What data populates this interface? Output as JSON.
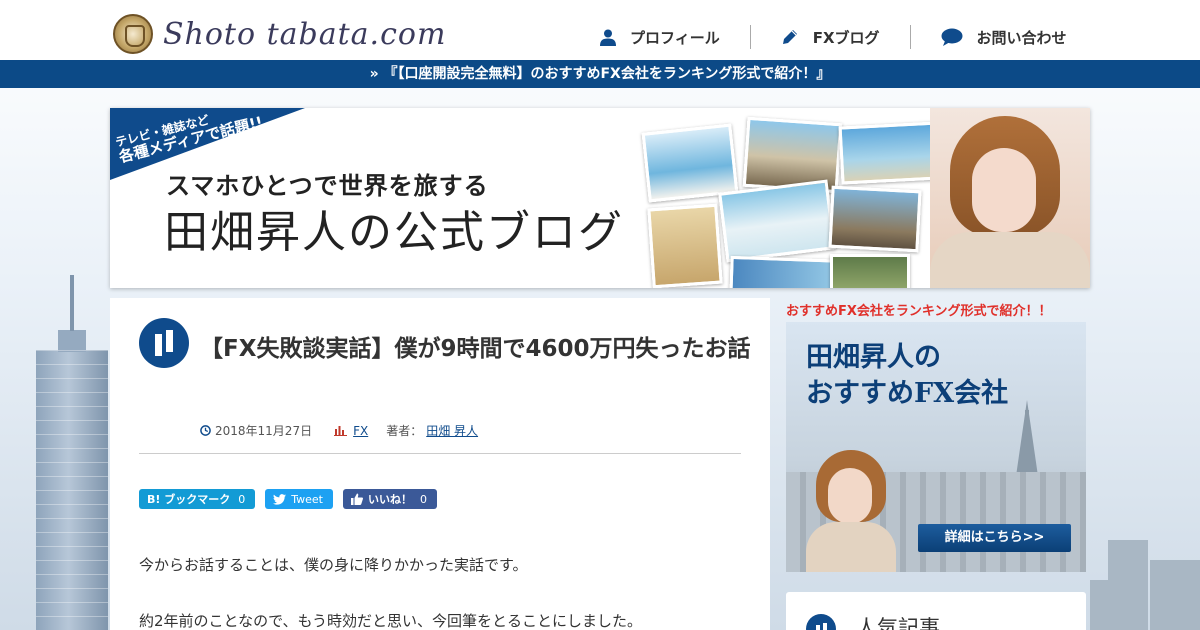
{
  "header": {
    "logo_text": "Shoto tabata.com",
    "nav": [
      {
        "label": "プロフィール",
        "icon": "user-icon"
      },
      {
        "label": "FXブログ",
        "icon": "pencil-icon"
      },
      {
        "label": "お問い合わせ",
        "icon": "chat-bubble-icon"
      }
    ]
  },
  "notice": {
    "text": "» 『【口座開設完全無料】のおすすめFX会社をランキング形式で紹介！』"
  },
  "hero": {
    "ribbon_line1": "テレビ・雑誌など",
    "ribbon_line2": "各種メディアで話題!!",
    "subtitle": "スマホひとつで世界を旅する",
    "title": "田畑昇人の公式ブログ"
  },
  "post": {
    "title": "【FX失敗談実話】僕が9時間で4600万円失ったお話",
    "date": "2018年11月27日",
    "category": "FX",
    "author_label": "著者：",
    "author": "田畑 昇人",
    "share": {
      "hatena_label": "B! ブックマーク",
      "hatena_count": "0",
      "twitter_label": "Tweet",
      "facebook_label": "いいね！",
      "facebook_count": "0"
    },
    "paragraphs": [
      "今からお話することは、僕の身に降りかかった実話です。",
      "約2年前のことなので、もう時効だと思い、今回筆をとることにしました。"
    ]
  },
  "sidebar": {
    "heading": "おすすめFX会社をランキング形式で紹介！！",
    "ad_title_line1": "田畑昇人の",
    "ad_title_line2": "おすすめFX会社",
    "ad_button": "詳細はこちら>>",
    "popular_title": "人気記事"
  },
  "colors": {
    "brand": "#0f4b8c",
    "notice_bar": "#0c4a87",
    "sidebar_heading": "#e0302a",
    "hatena": "#139bd5",
    "twitter": "#1da1f2",
    "facebook": "#3b5998"
  }
}
